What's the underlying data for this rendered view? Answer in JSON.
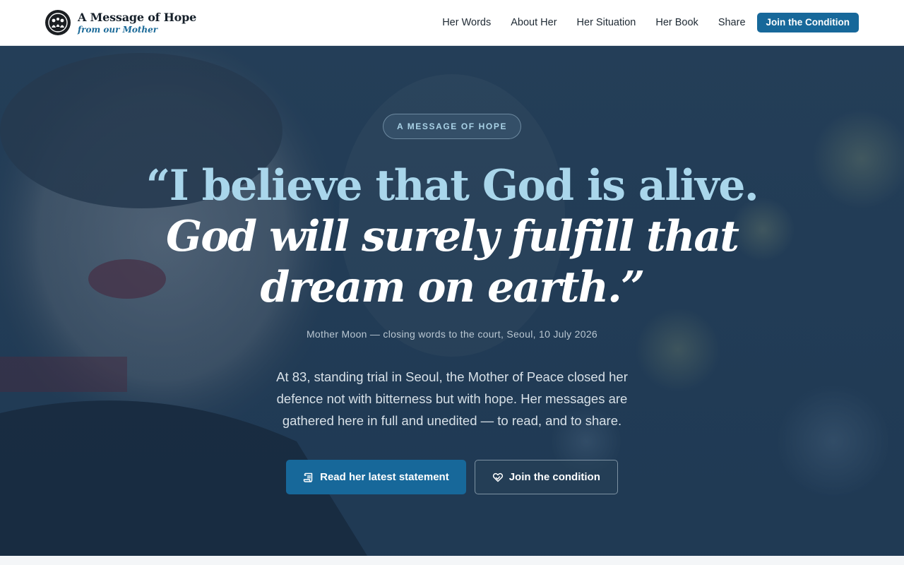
{
  "brand": {
    "title": "A Message of Hope",
    "subtitle": "from our Mother",
    "logo_icon": "family-emblem-icon"
  },
  "nav": {
    "items": [
      {
        "label": "Her Words"
      },
      {
        "label": "About Her"
      },
      {
        "label": "Her Situation"
      },
      {
        "label": "Her Book"
      },
      {
        "label": "Share"
      }
    ],
    "cta_label": "Join the Condition"
  },
  "hero": {
    "eyebrow": "A MESSAGE OF HOPE",
    "quote_line1": "“I believe that God is alive.",
    "quote_line2": "God will surely fulfill that",
    "quote_line3": "dream on earth.”",
    "attribution": "Mother Moon — closing words to the court, Seoul, 10 July 2026",
    "lead": "At 83, standing trial in Seoul, the Mother of Peace closed her defence not with bitterness but with hope. Her messages are gathered here in full and unedited — to read, and to share.",
    "primary_button": {
      "label": "Read her latest statement",
      "icon": "scroll-icon"
    },
    "secondary_button": {
      "label": "Join the condition",
      "icon": "heart-hands-icon"
    }
  },
  "colors": {
    "accent": "#17689a",
    "quote_highlight": "#a9d6eb",
    "header_bg": "#ffffff",
    "hero_overlay": "#1d3650"
  }
}
